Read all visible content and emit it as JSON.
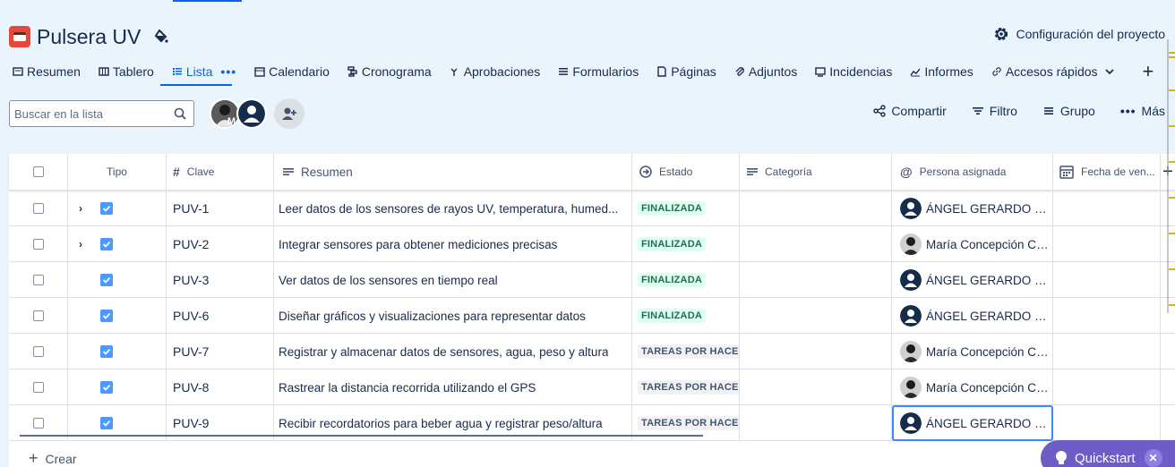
{
  "project": {
    "title": "Pulsera UV",
    "settings_label": "Configuración del proyecto"
  },
  "tabs": [
    {
      "label": "Resumen",
      "icon": "summary-icon"
    },
    {
      "label": "Tablero",
      "icon": "board-icon"
    },
    {
      "label": "Lista",
      "icon": "list-icon",
      "active": true
    },
    {
      "label": "Calendario",
      "icon": "calendar-icon"
    },
    {
      "label": "Cronograma",
      "icon": "timeline-icon"
    },
    {
      "label": "Aprobaciones",
      "icon": "approvals-icon"
    },
    {
      "label": "Formularios",
      "icon": "forms-icon"
    },
    {
      "label": "Páginas",
      "icon": "pages-icon"
    },
    {
      "label": "Adjuntos",
      "icon": "attachment-icon"
    },
    {
      "label": "Incidencias",
      "icon": "issues-icon"
    },
    {
      "label": "Informes",
      "icon": "reports-icon"
    },
    {
      "label": "Accesos rápidos",
      "icon": "link-icon"
    }
  ],
  "toolbar": {
    "search_placeholder": "Buscar en la lista",
    "avatar_initial": "M",
    "share_label": "Compartir",
    "filter_label": "Filtro",
    "group_label": "Grupo",
    "more_label": "Más"
  },
  "columns": {
    "type": "Tipo",
    "key": "Clave",
    "summary": "Resumen",
    "status": "Estado",
    "category": "Categoría",
    "assignee": "Persona asignada",
    "due_date": "Fecha de ven..."
  },
  "rows": [
    {
      "key": "PUV-1",
      "summary": "Leer datos de los sensores de rayos UV, temperatura, humed...",
      "status": "FINALIZADA",
      "status_kind": "done",
      "assignee": "ÁNGEL GERARDO VE...",
      "avatar": "generic",
      "expandable": true
    },
    {
      "key": "PUV-2",
      "summary": "Integrar sensores para obtener mediciones precisas",
      "status": "FINALIZADA",
      "status_kind": "done",
      "assignee": "María Concepción Cá...",
      "avatar": "photo",
      "expandable": true
    },
    {
      "key": "PUV-3",
      "summary": "Ver datos de los sensores en tiempo real",
      "status": "FINALIZADA",
      "status_kind": "done",
      "assignee": "ÁNGEL GERARDO VE...",
      "avatar": "generic",
      "expandable": false
    },
    {
      "key": "PUV-6",
      "summary": "Diseñar gráficos y visualizaciones para representar datos",
      "status": "FINALIZADA",
      "status_kind": "done",
      "assignee": "ÁNGEL GERARDO VE...",
      "avatar": "generic",
      "expandable": false
    },
    {
      "key": "PUV-7",
      "summary": "Registrar y almacenar datos de sensores, agua, peso y altura",
      "status": "TAREAS POR HACER",
      "status_kind": "todo",
      "assignee": "María Concepción Cá...",
      "avatar": "photo",
      "expandable": false
    },
    {
      "key": "PUV-8",
      "summary": "Rastrear la distancia recorrida utilizando el GPS",
      "status": "TAREAS POR HACER",
      "status_kind": "todo",
      "assignee": "María Concepción Cá...",
      "avatar": "photo",
      "expandable": false
    },
    {
      "key": "PUV-9",
      "summary": "Recibir recordatorios para beber agua y registrar peso/altura",
      "status": "TAREAS POR HACER",
      "status_kind": "todo",
      "assignee": "ÁNGEL GERARDO VE...",
      "avatar": "generic",
      "expandable": false,
      "selected_assignee": true
    }
  ],
  "footer": {
    "create_label": "Crear",
    "quickstart_label": "Quickstart"
  },
  "colors": {
    "accent": "#0c66e4",
    "background": "#e9f4fd",
    "done_bg": "#dcfff1",
    "done_text": "#216e4e",
    "todo_bg": "#f1f2f4",
    "todo_text": "#44546f",
    "quickstart": "#6e5dc6"
  }
}
